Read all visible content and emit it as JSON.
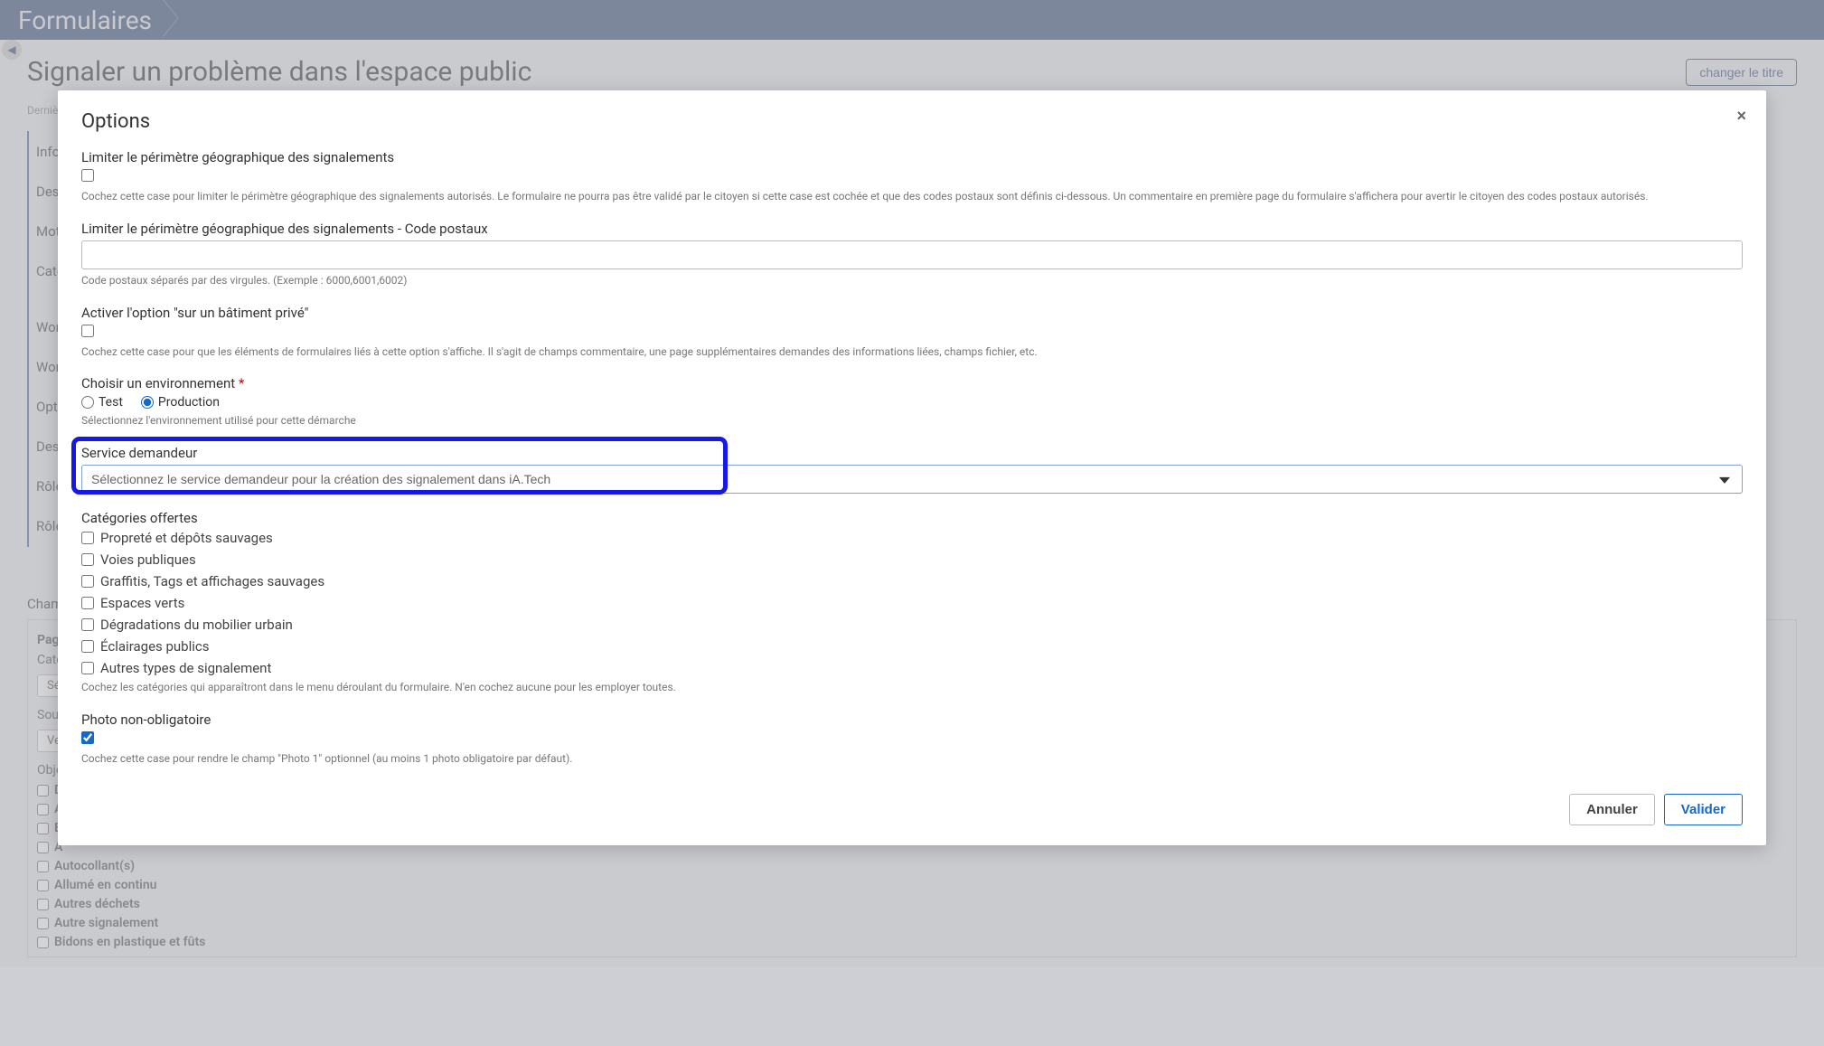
{
  "breadcrumb": {
    "root": "Formulaires"
  },
  "page": {
    "title": "Signaler un problème dans l'espace public",
    "change_title_btn": "changer le titre",
    "last_modified": "Dernière m"
  },
  "sidenav": {
    "items": [
      "Infor",
      "Desc",
      "Mots-",
      "Catég",
      "Workf",
      "Workf",
      "Optio",
      "Desti",
      "Rôles",
      "Rôle p"
    ]
  },
  "bg": {
    "champ": "Cham",
    "page_label": "Page",
    "cat_label": "Caté",
    "select1": "Sél",
    "sous_label": "Sous",
    "select2": "Veu",
    "obj_label": "Obje",
    "checks": [
      "D",
      "A",
      "B",
      "A",
      "Autocollant(s)",
      "Allumé en continu",
      "Autres déchets",
      "Autre signalement",
      "Bidons en plastique et fûts"
    ]
  },
  "modal": {
    "title": "Options",
    "close": "×",
    "perimeter": {
      "label": "Limiter le périmètre géographique des signalements",
      "help": "Cochez cette case pour limiter le périmètre géographique des signalements autorisés. Le formulaire ne pourra pas être validé par le citoyen si cette case est cochée et que des codes postaux sont définis ci-dessous. Un commentaire en première page du formulaire s'affichera pour avertir le citoyen des codes postaux autorisés."
    },
    "postal": {
      "label": "Limiter le périmètre géographique des signalements - Code postaux",
      "help": "Code postaux séparés par des virgules. (Exemple : 6000,6001,6002)"
    },
    "private": {
      "label": "Activer l'option \"sur un bâtiment privé\"",
      "help": "Cochez cette case pour que les éléments de formulaires liés à cette option s'affiche. Il s'agit de champs commentaire, une page supplémentaires demandes des informations liées, champs fichier, etc."
    },
    "env": {
      "label": "Choisir un environnement",
      "req": "*",
      "test": "Test",
      "prod": "Production",
      "help": "Sélectionnez l'environnement utilisé pour cette démarche"
    },
    "service": {
      "label": "Service demandeur",
      "placeholder": "Sélectionnez le service demandeur pour la création des signalement dans iA.Tech"
    },
    "categories": {
      "label": "Catégories offertes",
      "items": [
        "Propreté et dépôts sauvages",
        "Voies publiques",
        "Graffitis, Tags et affichages sauvages",
        "Espaces verts",
        "Dégradations du mobilier urbain",
        "Éclairages publics",
        "Autres types de signalement"
      ],
      "help": "Cochez les catégories qui apparaîtront dans le menu déroulant du formulaire. N'en cochez aucune pour les employer toutes."
    },
    "photo": {
      "label": "Photo non-obligatoire",
      "help": "Cochez cette case pour rendre le champ \"Photo 1\" optionnel (au moins 1 photo obligatoire par défaut)."
    },
    "cancel": "Annuler",
    "submit": "Valider"
  }
}
